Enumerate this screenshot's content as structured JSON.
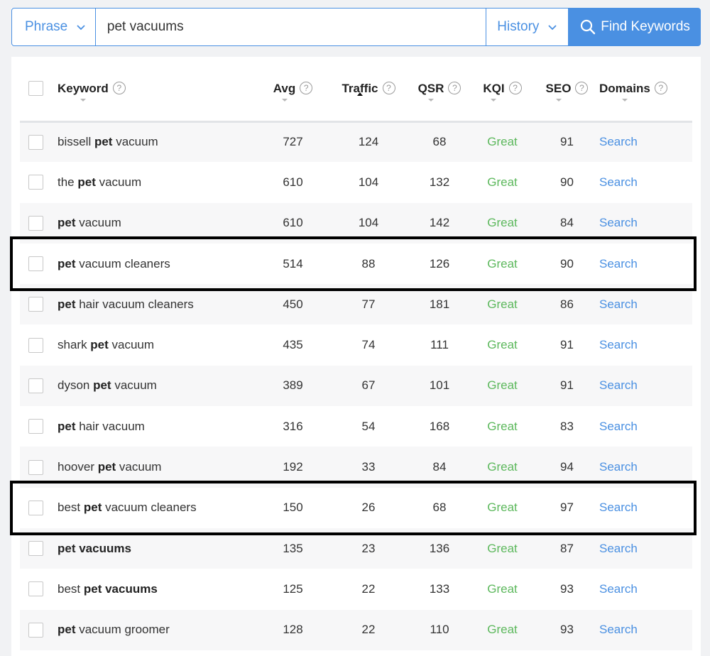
{
  "search": {
    "mode_label": "Phrase",
    "query": "pet vacuums",
    "history_label": "History",
    "find_label": "Find Keywords"
  },
  "table": {
    "headers": {
      "keyword": "Keyword",
      "avg": "Avg",
      "traffic": "Traffic",
      "qsr": "QSR",
      "kqi": "KQI",
      "seo": "SEO",
      "domains": "Domains"
    },
    "help_glyph": "?",
    "sorted_column": "traffic",
    "rows": [
      {
        "kw_pre": "bissell ",
        "kw_bold": "pet",
        "kw_post": " vacuum",
        "avg": "727",
        "traffic": "124",
        "qsr": "68",
        "kqi": "Great",
        "seo": "91",
        "domains": "Search",
        "highlighted": false
      },
      {
        "kw_pre": "the ",
        "kw_bold": "pet",
        "kw_post": " vacuum",
        "avg": "610",
        "traffic": "104",
        "qsr": "132",
        "kqi": "Great",
        "seo": "90",
        "domains": "Search",
        "highlighted": false
      },
      {
        "kw_pre": "",
        "kw_bold": "pet",
        "kw_post": " vacuum",
        "avg": "610",
        "traffic": "104",
        "qsr": "142",
        "kqi": "Great",
        "seo": "84",
        "domains": "Search",
        "highlighted": false
      },
      {
        "kw_pre": "",
        "kw_bold": "pet",
        "kw_post": " vacuum cleaners",
        "avg": "514",
        "traffic": "88",
        "qsr": "126",
        "kqi": "Great",
        "seo": "90",
        "domains": "Search",
        "highlighted": true
      },
      {
        "kw_pre": "",
        "kw_bold": "pet",
        "kw_post": " hair vacuum cleaners",
        "avg": "450",
        "traffic": "77",
        "qsr": "181",
        "kqi": "Great",
        "seo": "86",
        "domains": "Search",
        "highlighted": false
      },
      {
        "kw_pre": "shark ",
        "kw_bold": "pet",
        "kw_post": " vacuum",
        "avg": "435",
        "traffic": "74",
        "qsr": "111",
        "kqi": "Great",
        "seo": "91",
        "domains": "Search",
        "highlighted": false
      },
      {
        "kw_pre": "dyson ",
        "kw_bold": "pet",
        "kw_post": " vacuum",
        "avg": "389",
        "traffic": "67",
        "qsr": "101",
        "kqi": "Great",
        "seo": "91",
        "domains": "Search",
        "highlighted": false
      },
      {
        "kw_pre": "",
        "kw_bold": "pet",
        "kw_post": " hair vacuum",
        "avg": "316",
        "traffic": "54",
        "qsr": "168",
        "kqi": "Great",
        "seo": "83",
        "domains": "Search",
        "highlighted": false
      },
      {
        "kw_pre": "hoover ",
        "kw_bold": "pet",
        "kw_post": " vacuum",
        "avg": "192",
        "traffic": "33",
        "qsr": "84",
        "kqi": "Great",
        "seo": "94",
        "domains": "Search",
        "highlighted": false
      },
      {
        "kw_pre": "best ",
        "kw_bold": "pet",
        "kw_post": " vacuum cleaners",
        "avg": "150",
        "traffic": "26",
        "qsr": "68",
        "kqi": "Great",
        "seo": "97",
        "domains": "Search",
        "highlighted": true
      },
      {
        "kw_pre": "",
        "kw_bold": "pet vacuums",
        "kw_post": "",
        "avg": "135",
        "traffic": "23",
        "qsr": "136",
        "kqi": "Great",
        "seo": "87",
        "domains": "Search",
        "highlighted": false
      },
      {
        "kw_pre": "best ",
        "kw_bold": "pet vacuums",
        "kw_post": "",
        "avg": "125",
        "traffic": "22",
        "qsr": "133",
        "kqi": "Great",
        "seo": "93",
        "domains": "Search",
        "highlighted": false
      },
      {
        "kw_pre": "",
        "kw_bold": "pet",
        "kw_post": " vacuum groomer",
        "avg": "128",
        "traffic": "22",
        "qsr": "110",
        "kqi": "Great",
        "seo": "93",
        "domains": "Search",
        "highlighted": false
      }
    ]
  },
  "colors": {
    "accent": "#4a90e2",
    "kqi_great": "#5cb85c",
    "highlight_border": "#000000"
  }
}
